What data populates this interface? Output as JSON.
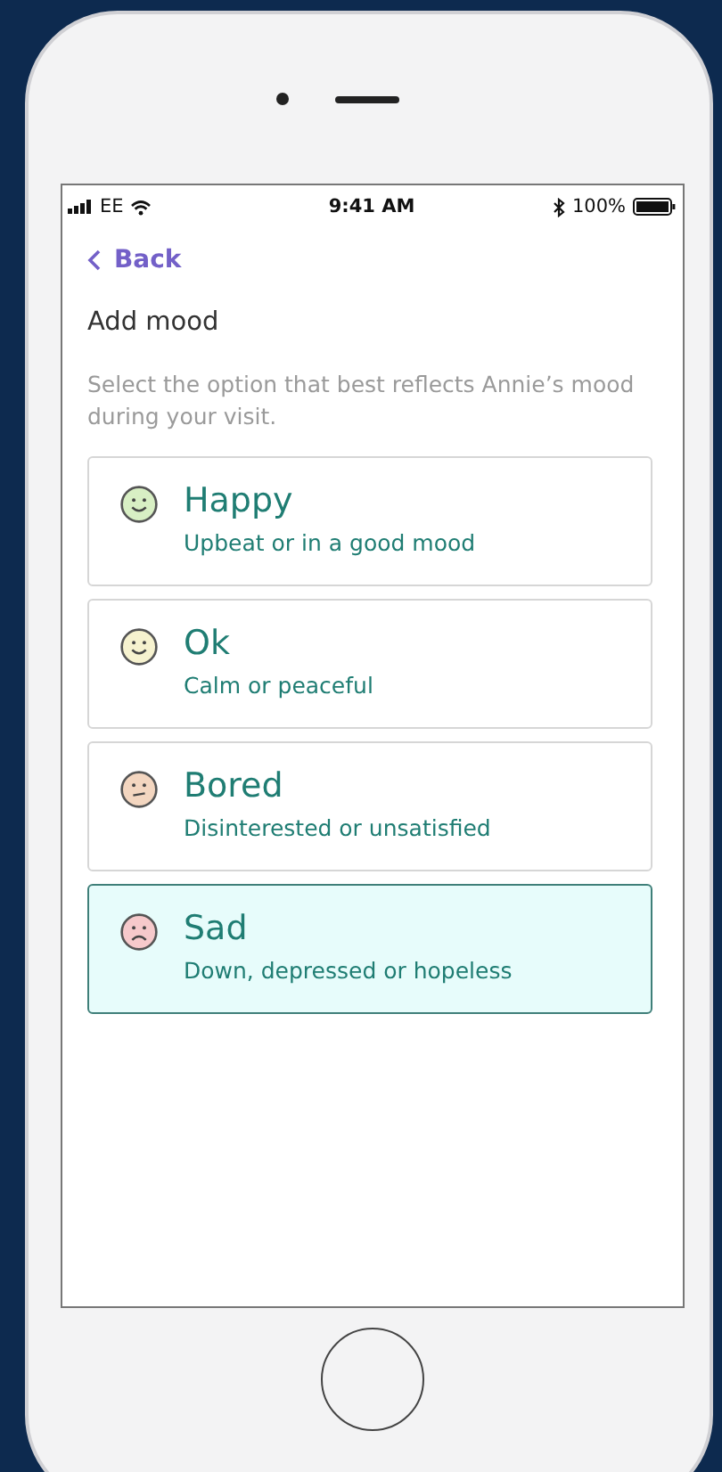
{
  "status_bar": {
    "carrier": "EE",
    "time": "9:41 AM",
    "battery": "100%"
  },
  "nav": {
    "back": "Back"
  },
  "title": "Add mood",
  "instruction": "Select the option that best reflects Annie’s mood during your visit.",
  "moods": [
    {
      "label": "Happy",
      "description": "Upbeat or in a good mood",
      "kind": "smile",
      "color": "#d8efc4",
      "selected": false
    },
    {
      "label": "Ok",
      "description": "Calm or peaceful",
      "kind": "smile",
      "color": "#f6f2cf",
      "selected": false
    },
    {
      "label": "Bored",
      "description": "Disinterested or unsatisfied",
      "kind": "flat",
      "color": "#f3d6c0",
      "selected": false
    },
    {
      "label": "Sad",
      "description": "Down, depressed or hopeless",
      "kind": "frown",
      "color": "#f6c9cb",
      "selected": true
    }
  ]
}
